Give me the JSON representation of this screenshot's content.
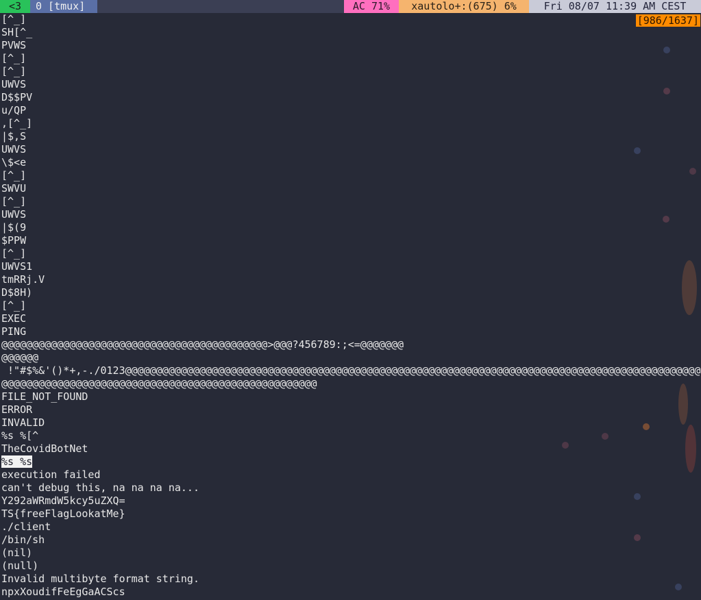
{
  "statusbar": {
    "heart": "<3",
    "window": "0 [tmux]",
    "battery": "AC 71%",
    "xautolock": "xautolo+:(675) 6%",
    "datetime": "Fri 08/07 11:39 AM CEST"
  },
  "pager": {
    "position": "[986/1637]"
  },
  "colors": {
    "background": "#272a37",
    "statusbar_background": "#3b3f54",
    "heart_green": "#29c25a",
    "window_blue": "#5a6fa6",
    "battery_pink": "#ff6fbf",
    "xautolock_orange": "#f5b46e",
    "datetime_gray": "#c9cbd8",
    "position_orange": "#ff8b00",
    "highlight": "#f2f2f2"
  },
  "terminal": {
    "highlighted_index": 34,
    "lines": [
      "[^_]",
      "SH[^_",
      "PVWS",
      "[^_]",
      "[^_]",
      "UWVS",
      "D$$PV",
      "u/QP",
      ",[^_]",
      "|$,S",
      "UWVS",
      "\\$<e",
      "[^_]",
      "SWVU",
      "[^_]",
      "UWVS",
      "|$(9",
      "$PPW",
      "[^_]",
      "UWVS1",
      "tmRRj.V",
      "D$8H)",
      "[^_]",
      "EXEC",
      "PING",
      "@@@@@@@@@@@@@@@@@@@@@@@@@@@@@@@@@@@@@@@@@@@>@@@?456789:;<=@@@@@@@",
      "@@@@@@",
      " !\"#$%&'()*+,-./0123@@@@@@@@@@@@@@@@@@@@@@@@@@@@@@@@@@@@@@@@@@@@@@@@@@@@@@@@@@@@@@@@@@@@@@@@@@@@@@@@@@@@@@@@@@@@@",
      "@@@@@@@@@@@@@@@@@@@@@@@@@@@@@@@@@@@@@@@@@@@@@@@@@@@",
      "FILE_NOT_FOUND",
      "ERROR",
      "INVALID",
      "%s %[^",
      "TheCovidBotNet",
      "%s %s",
      "execution failed",
      "can't debug this, na na na na...",
      "Y292aWRmdW5kcy5uZXQ=",
      "TS{freeFlagLookatMe}",
      "./client",
      "/bin/sh",
      "(nil)",
      "(null)",
      "Invalid multibyte format string.",
      "npxXoudifFeEgGaACScs"
    ]
  }
}
